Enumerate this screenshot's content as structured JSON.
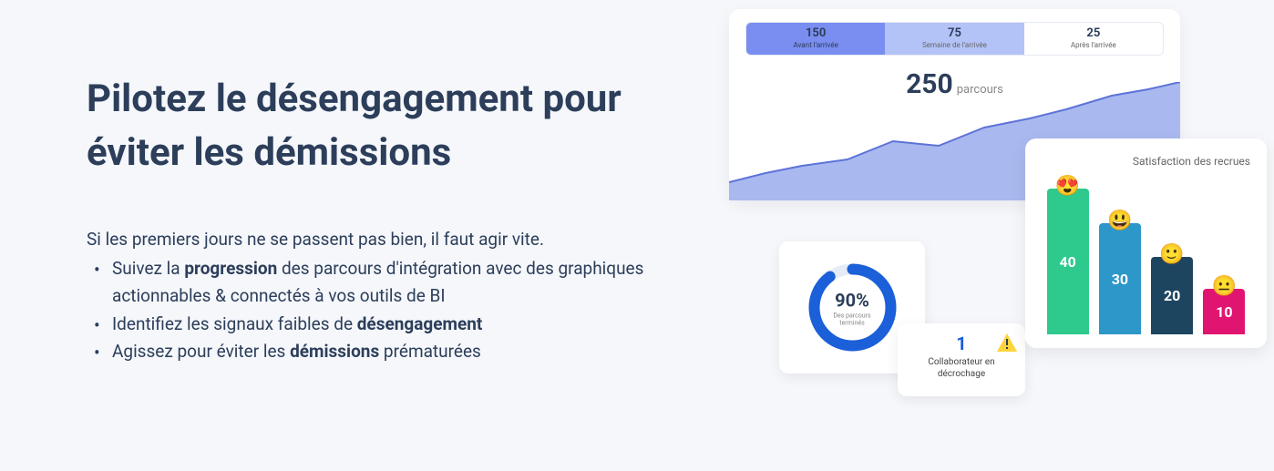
{
  "heading": "Pilotez le désengagement pour éviter les démissions",
  "intro": "Si les premiers jours ne se passent pas bien, il faut agir vite.",
  "bullets": {
    "b1_pre": "Suivez la ",
    "b1_bold": "progression",
    "b1_post": " des parcours d'intégration avec des graphiques actionnables & connectés à vos outils de BI",
    "b2_pre": "Identifiez les signaux faibles de ",
    "b2_bold": "désengagement",
    "b3_pre": "Agissez pour éviter les ",
    "b3_bold": "démissions",
    "b3_post": " prématurées"
  },
  "tabs": {
    "t1_num": "150",
    "t1_label": "Avant l'arrivée",
    "t2_num": "75",
    "t2_label": "Semaine de l'arrivée",
    "t3_num": "25",
    "t3_label": "Après l'arrivée"
  },
  "chart": {
    "value": "250",
    "unit": "parcours"
  },
  "donut": {
    "pct": "90%",
    "label": "Des parcours terminés"
  },
  "alert": {
    "num": "1",
    "text": "Collaborateur en décrochage"
  },
  "satisfaction": {
    "title": "Satisfaction des recrues",
    "bars": {
      "v1": "40",
      "v2": "30",
      "v3": "20",
      "v4": "10",
      "e1": "😍",
      "e2": "😃",
      "e3": "🙂",
      "e4": "😐"
    }
  },
  "chart_data": [
    {
      "type": "bar",
      "title": "Satisfaction des recrues",
      "categories": [
        "😍",
        "😃",
        "🙂",
        "😐"
      ],
      "values": [
        40,
        30,
        20,
        10
      ]
    },
    {
      "type": "line",
      "title": "parcours",
      "value_label": 250,
      "tabs": [
        {
          "label": "Avant l'arrivée",
          "value": 150
        },
        {
          "label": "Semaine de l'arrivée",
          "value": 75
        },
        {
          "label": "Après l'arrivée",
          "value": 25
        }
      ]
    },
    {
      "type": "pie",
      "title": "Des parcours terminés",
      "values": [
        90,
        10
      ]
    }
  ]
}
